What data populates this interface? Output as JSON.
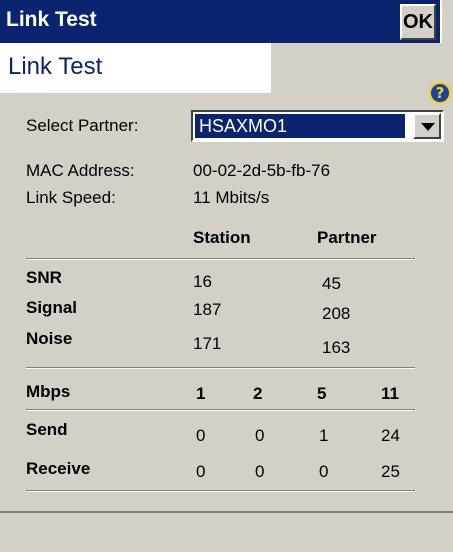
{
  "window": {
    "title": "Link Test",
    "ok_label": "OK"
  },
  "header": {
    "title": "Link Test",
    "help_glyph": "?"
  },
  "form": {
    "partner_label": "Select Partner:",
    "partner_value": "HSAXMO1",
    "mac_label": "MAC Address:",
    "mac_value": "00-02-2d-5b-fb-76",
    "speed_label": "Link Speed:",
    "speed_value": "11 Mbits/s"
  },
  "stats": {
    "col_station": "Station",
    "col_partner": "Partner",
    "rows": [
      {
        "label": "SNR",
        "station": "16",
        "partner": "45"
      },
      {
        "label": "Signal",
        "station": "187",
        "partner": "208"
      },
      {
        "label": "Noise",
        "station": "171",
        "partner": "163"
      }
    ]
  },
  "rates": {
    "header_label": "Mbps",
    "columns": [
      "1",
      "2",
      "5",
      "11"
    ],
    "rows": [
      {
        "label": "Send",
        "values": [
          "0",
          "0",
          "1",
          "24"
        ]
      },
      {
        "label": "Receive",
        "values": [
          "0",
          "0",
          "0",
          "25"
        ]
      }
    ]
  },
  "colors": {
    "titlebar": "#0a2470",
    "background": "#d4d0c8",
    "help_icon": "#1c3ea8"
  }
}
